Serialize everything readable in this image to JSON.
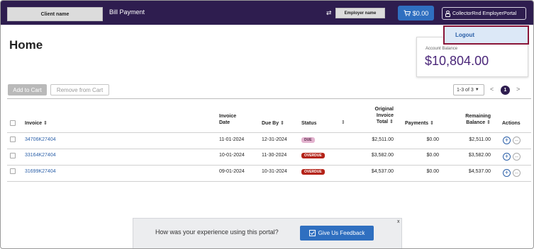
{
  "header": {
    "client_name": "Client name",
    "title": "Bill Payment",
    "employer_name": "Employer name",
    "cart_amount": "$0.00",
    "user_label": "CollectorRnd EmployerPortal"
  },
  "user_menu": {
    "logout_label": "Logout"
  },
  "page": {
    "title": "Home"
  },
  "balance": {
    "label": "Account Balance",
    "value": "$10,804.00"
  },
  "actions": {
    "add_to_cart": "Add to Cart",
    "remove_from_cart": "Remove from Cart"
  },
  "pagination": {
    "range": "1-3 of 3",
    "current_page": "1"
  },
  "table": {
    "headers": {
      "invoice": "Invoice",
      "invoice_date_1": "Invoice",
      "invoice_date_2": "Date",
      "due_by": "Due By",
      "status": "Status",
      "orig_1": "Original",
      "orig_2": "Invoice",
      "orig_3": "Total",
      "payments": "Payments",
      "remaining_1": "Remaining",
      "remaining_2": "Balance",
      "actions": "Actions"
    },
    "rows": [
      {
        "invoice": "34706K27404",
        "invoice_date": "11-01-2024",
        "due_by": "12-31-2024",
        "status": "DUE",
        "original_total": "$2,511.00",
        "payments": "$0.00",
        "remaining": "$2,511.00"
      },
      {
        "invoice": "33164K27404",
        "invoice_date": "10-01-2024",
        "due_by": "11-30-2024",
        "status": "OVERDUE",
        "original_total": "$3,582.00",
        "payments": "$0.00",
        "remaining": "$3,582.00"
      },
      {
        "invoice": "31699K27404",
        "invoice_date": "09-01-2024",
        "due_by": "10-31-2024",
        "status": "OVERDUE",
        "original_total": "$4,537.00",
        "payments": "$0.00",
        "remaining": "$4,537.00"
      }
    ]
  },
  "feedback": {
    "question": "How was your experience using this portal?",
    "button_label": "Give Us Feedback",
    "close_label": "x"
  },
  "colors": {
    "header_bg": "#2e1d4f",
    "primary_button": "#2f6fc0",
    "balance_text": "#4a2679",
    "due_badge": "#e3b3cf",
    "overdue_badge": "#b42318",
    "logout_border": "#8a1538"
  },
  "icons": {
    "swap": "swap-arrows-icon",
    "cart": "cart-icon",
    "user": "user-lock-icon",
    "sort": "sort-icon",
    "add": "plus-circle-icon",
    "remove": "minus-circle-icon",
    "feedback": "feedback-icon"
  }
}
